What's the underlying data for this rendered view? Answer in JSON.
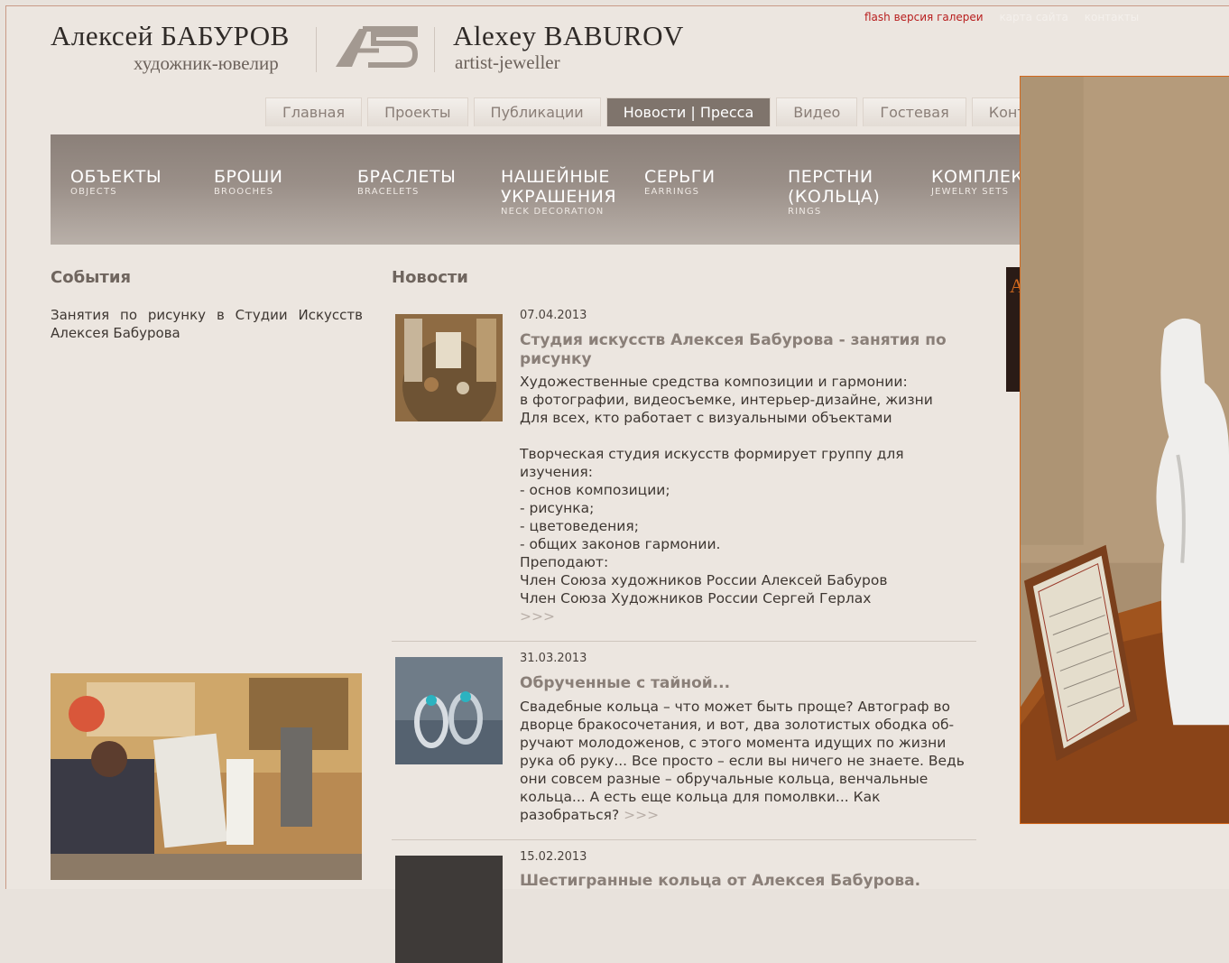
{
  "header": {
    "name_ru": "Алексей БАБУРОВ",
    "role_ru": "художник-ювелир",
    "logo_text": "АБ",
    "name_en": "Alexey BABUROV",
    "role_en": "artist-jeweller",
    "top_links": {
      "flash": "flash версия галереи",
      "faded_1": "карта сайта",
      "faded_2": "контакты"
    }
  },
  "main_menu": [
    {
      "label": "Главная"
    },
    {
      "label": "Проекты"
    },
    {
      "label": "Публикации"
    },
    {
      "label": "Новости | Пресса",
      "active": true
    },
    {
      "label": "Видео"
    },
    {
      "label": "Гостевая"
    },
    {
      "label": "Контакты"
    }
  ],
  "categories": [
    {
      "ru": "Объекты",
      "en": "OBJECTS"
    },
    {
      "ru": "Броши",
      "en": "BROOCHES"
    },
    {
      "ru": "Браслеты",
      "en": "BRACELETS"
    },
    {
      "ru": "Нашейные украшения",
      "en": "NECK DECORATION"
    },
    {
      "ru": "Серьги",
      "en": "EARRINGS"
    },
    {
      "ru": "Перстни (кольца)",
      "en": "RINGS"
    },
    {
      "ru": "Комплекты",
      "en": "JEWELRY SETS"
    }
  ],
  "events": {
    "title": "События",
    "text": "Занятия по рисунку в Студии Искусств Алексея Бабурова"
  },
  "news": {
    "title": "Новости",
    "items": [
      {
        "date": "07.04.2013",
        "title": "Студия искусств Алексея Бабурова - занятия по рисунку",
        "body": "Художественные средства композиции и гармонии:\nв фотографии, видеосъемке, интерьер-дизайне, жизни\nДля всех, кто работает с визуальными объектами\n\nТворческая студия искусств формирует группу для изучения:\n- основ композиции;\n- рисунка;\n- цветоведения;\n- общих законов гармонии.\nПреподают:\nЧлен Союза художников России Алексей Бабуров\nЧлен Союза Художников России Сергей Герлах",
        "more": ">>>"
      },
      {
        "date": "31.03.2013",
        "title": "Обрученные с тайной...",
        "body": "Свадебные кольца – что может быть проще? Автограф во дворце бракосочетания, и вот, два золотистых ободка об-ручают молодоженов, с этого момента идущих по жизни рука об руку... Все просто – если вы ничего не знаете. Ведь они совсем разные – обручальные кольца, венчальные кольца... А есть еще кольца для помолвки... Как разобраться?",
        "more": ">>>"
      },
      {
        "date": "15.02.2013",
        "title": "Шестигранные кольца от Алексея Бабурова."
      }
    ]
  },
  "banner": {
    "letter": "А"
  }
}
